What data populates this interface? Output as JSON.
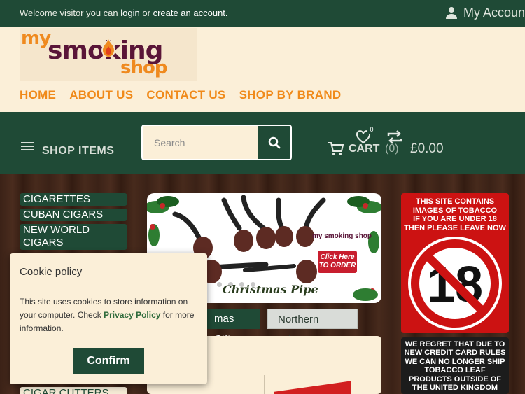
{
  "topbar": {
    "welcome_prefix": "Welcome visitor you can",
    "login": "login",
    "or": "or",
    "create_account": "create an account.",
    "my_account": "My Account"
  },
  "logo": {
    "my": "my",
    "smoking": "smoking",
    "shop": "shop"
  },
  "nav": [
    "HOME",
    "ABOUT US",
    "CONTACT US",
    "SHOP BY BRAND"
  ],
  "toolbar": {
    "shop_items": "SHOP ITEMS",
    "search_placeholder": "Search",
    "wishlist_count": "0",
    "cart_label": "CART",
    "cart_count": "(0)",
    "cart_total": "£0.00"
  },
  "categories": [
    "CIGARETTES",
    "CUBAN CIGARS",
    "NEW WORLD",
    "CIGARS",
    "CIGAR CUTTERS"
  ],
  "banner": {
    "caption": "Christmas Pipe",
    "click_here": "Click Here",
    "to_order": "TO ORDER",
    "mini_logo": "my smoking shop"
  },
  "tabs": [
    "mas Gifts",
    "Northern Briars"
  ],
  "warning": {
    "age_notice": [
      "THIS SITE CONTAINS",
      "IMAGES OF TOBACCO",
      "IF YOU ARE UNDER 18",
      "THEN PLEASE LEAVE NOW"
    ],
    "age_number": "18",
    "shipping_notice": [
      "WE REGRET THAT DUE TO",
      "NEW CREDIT CARD RULES",
      "WE CAN NO LONGER SHIP",
      "TOBACCO LEAF",
      "PRODUCTS OUTSIDE OF",
      "THE UNITED KINGDOM"
    ]
  },
  "cookie": {
    "title": "Cookie policy",
    "text_before": "This site uses cookies to store information on your computer. Check",
    "link": "Privacy Policy",
    "text_after": "for more information.",
    "confirm": "Confirm"
  },
  "colors": {
    "dark_green": "#1f4a36",
    "orange": "#f08a1a",
    "cream": "#fbefd8",
    "warning_red": "#cc1212"
  },
  "icons": [
    "user-icon",
    "menu-icon",
    "search-icon",
    "cart-icon",
    "heart-icon",
    "compare-icon",
    "no-under-18-icon"
  ]
}
